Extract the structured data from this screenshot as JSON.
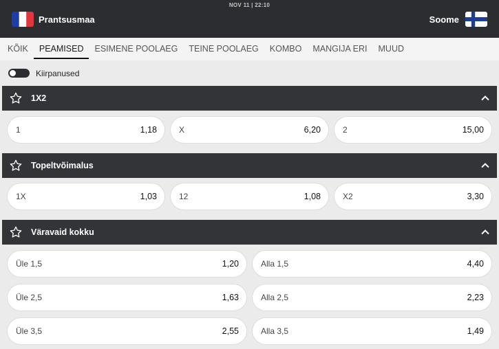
{
  "match": {
    "datetime": "NOV 11 | 22:10",
    "home_team": "Prantsusmaa",
    "away_team": "Soome"
  },
  "tabs": [
    {
      "label": "KÕIK",
      "active": false
    },
    {
      "label": "PEAMISED",
      "active": true
    },
    {
      "label": "ESIMENE POOLAEG",
      "active": false
    },
    {
      "label": "TEINE POOLAEG",
      "active": false
    },
    {
      "label": "KOMBO",
      "active": false
    },
    {
      "label": "MANGIJA ERI",
      "active": false
    },
    {
      "label": "MUUD",
      "active": false
    }
  ],
  "quick_bet": {
    "label": "Kiirpanused",
    "enabled": false
  },
  "sections": [
    {
      "title": "1X2",
      "odds": [
        {
          "label": "1",
          "value": "1,18"
        },
        {
          "label": "X",
          "value": "6,20"
        },
        {
          "label": "2",
          "value": "15,00"
        }
      ]
    },
    {
      "title": "Topeltvõimalus",
      "odds": [
        {
          "label": "1X",
          "value": "1,03"
        },
        {
          "label": "12",
          "value": "1,08"
        },
        {
          "label": "X2",
          "value": "3,30"
        }
      ]
    },
    {
      "title": "Väravaid kokku",
      "odds": [
        {
          "label": "Üle 1,5",
          "value": "1,20"
        },
        {
          "label": "Alla 1,5",
          "value": "4,40"
        },
        {
          "label": "Üle 2,5",
          "value": "1,63"
        },
        {
          "label": "Alla 2,5",
          "value": "2,23"
        },
        {
          "label": "Üle 3,5",
          "value": "2,55"
        },
        {
          "label": "Alla 3,5",
          "value": "1,49"
        }
      ]
    }
  ],
  "colors": {
    "header_bg": "#2b2d30",
    "section_bg": "#323438",
    "page_bg": "#ebebeb"
  }
}
